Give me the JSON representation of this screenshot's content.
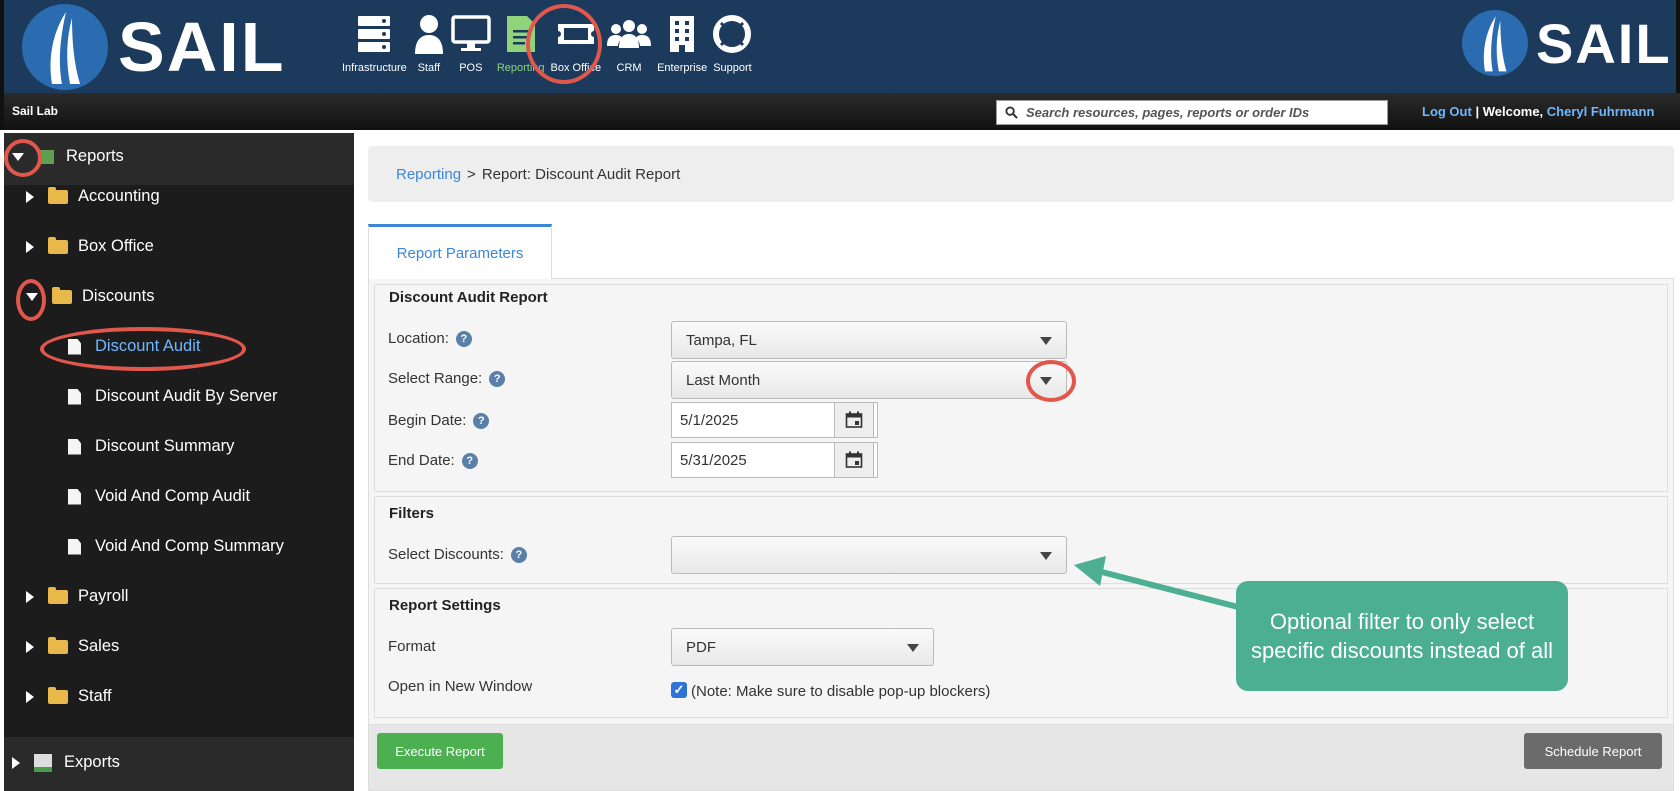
{
  "app": {
    "brand": "SAIL",
    "site_name": "Sail Lab"
  },
  "nav": {
    "items": [
      {
        "label": "Infrastructure",
        "icon": "server-icon"
      },
      {
        "label": "Staff",
        "icon": "person-icon"
      },
      {
        "label": "POS",
        "icon": "monitor-icon"
      },
      {
        "label": "Reporting",
        "icon": "report-document-icon",
        "active": true
      },
      {
        "label": "Box Office",
        "icon": "ticket-icon"
      },
      {
        "label": "CRM",
        "icon": "people-group-icon"
      },
      {
        "label": "Enterprise",
        "icon": "building-icon"
      },
      {
        "label": "Support",
        "icon": "lifebuoy-icon"
      }
    ],
    "active_color": "#8fd47a"
  },
  "search": {
    "placeholder": "Search resources, pages, reports or order IDs"
  },
  "user": {
    "logout": "Log Out",
    "separator": "|",
    "welcome": "Welcome,",
    "name": "Cheryl Fuhrmann"
  },
  "sidebar": {
    "root": "Reports",
    "folders": [
      {
        "label": "Accounting",
        "expanded": false
      },
      {
        "label": "Box Office",
        "expanded": false
      },
      {
        "label": "Discounts",
        "expanded": true
      },
      {
        "label": "Payroll",
        "expanded": false
      },
      {
        "label": "Sales",
        "expanded": false
      },
      {
        "label": "Staff",
        "expanded": false
      }
    ],
    "discount_reports": [
      {
        "label": "Discount Audit",
        "selected": true
      },
      {
        "label": "Discount Audit By Server"
      },
      {
        "label": "Discount Summary"
      },
      {
        "label": "Void And Comp Audit"
      },
      {
        "label": "Void And Comp Summary"
      }
    ],
    "exports": "Exports"
  },
  "breadcrumb": {
    "link": "Reporting",
    "sep": ">",
    "current": "Report: Discount Audit Report"
  },
  "tab": {
    "label": "Report Parameters"
  },
  "report": {
    "section_title": "Discount Audit Report",
    "location_label": "Location:",
    "location_value": "Tampa, FL",
    "range_label": "Select Range:",
    "range_value": "Last Month",
    "begin_label": "Begin Date:",
    "begin_value": "5/1/2025",
    "end_label": "End Date:",
    "end_value": "5/31/2025"
  },
  "filters": {
    "section_title": "Filters",
    "discounts_label": "Select Discounts:",
    "discounts_value": ""
  },
  "settings": {
    "section_title": "Report Settings",
    "format_label": "Format",
    "format_value": "PDF",
    "new_window_label": "Open in New Window",
    "new_window_checked": true,
    "new_window_note": "(Note: Make sure to disable pop-up blockers)"
  },
  "actions": {
    "execute": "Execute Report",
    "schedule": "Schedule Report"
  },
  "annotation": {
    "callout": "Optional filter to only select specific discounts instead of all",
    "color": "#4caf91"
  },
  "colors": {
    "header": "#1b3a5c",
    "link": "#3a87d6",
    "highlight_ring": "#e2574c",
    "execute": "#4caf50"
  }
}
